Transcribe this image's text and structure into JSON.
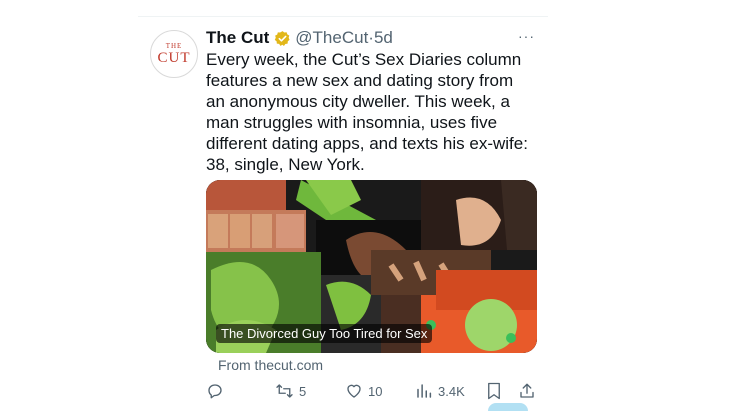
{
  "tweet": {
    "author_name": "The Cut",
    "handle": "@TheCut",
    "dot": "·",
    "time": "5d",
    "avatar_small": "THE",
    "avatar_big": "CUT",
    "more": "···",
    "text": "Every week, the Cut’s Sex Diaries column features a new sex and dating story from an anonymous city dweller. This week, a man struggles with insomnia, uses five different dating apps, and texts his ex-wife: 38, single, New York.",
    "media_caption": "The Divorced Guy Too Tired for Sex",
    "source": "From thecut.com"
  },
  "actions": {
    "reply_count": "",
    "retweet_count": "5",
    "like_count": "10",
    "views_count": "3.4K"
  },
  "icons": {
    "verified": "gold-verified-badge-icon",
    "reply": "reply-icon",
    "retweet": "retweet-icon",
    "like": "heart-icon",
    "views": "views-chart-icon",
    "bookmark": "bookmark-icon",
    "share": "share-icon",
    "more": "more-dots-icon"
  },
  "colors": {
    "text": "#0f1419",
    "secondary": "#536471",
    "verified_gold": "#e2b719",
    "brand_red": "#c0392b"
  }
}
